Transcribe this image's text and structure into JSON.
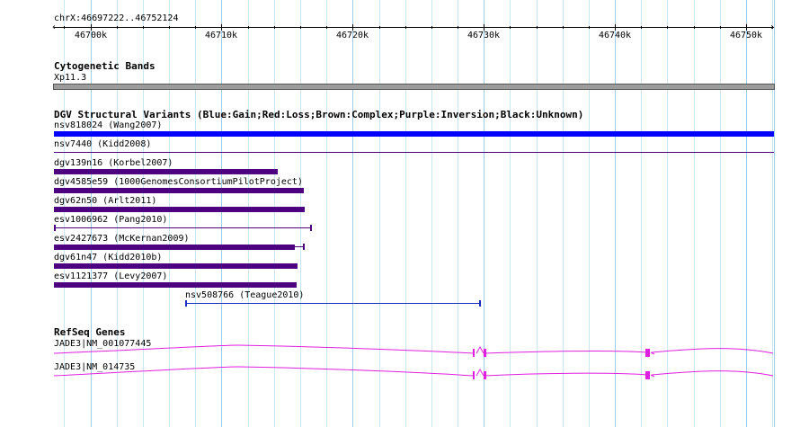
{
  "location": {
    "label": "chrX:46697222..46752124"
  },
  "ruler": {
    "ticks": [
      {
        "pos": 46700000,
        "label": "46700k"
      },
      {
        "pos": 46710000,
        "label": "46710k"
      },
      {
        "pos": 46720000,
        "label": "46720k"
      },
      {
        "pos": 46730000,
        "label": "46730k"
      },
      {
        "pos": 46740000,
        "label": "46740k"
      },
      {
        "pos": 46750000,
        "label": "46750k"
      }
    ]
  },
  "cytobands": {
    "title": "Cytogenetic Bands",
    "band_label": "Xp11.3",
    "band_color": "#9c9c9c"
  },
  "dgv": {
    "title": "DGV Structural Variants (Blue:Gain;Red:Loss;Brown:Complex;Purple:Inversion;Black:Unknown)",
    "colors": {
      "gain": "#0000ff",
      "inversion": "#4d0080",
      "gain_thin": "#1a2fbf"
    },
    "variants": [
      {
        "id": "nsv818024",
        "label": "nsv818024 (Wang2007)",
        "start": 46697222,
        "end": 46752124,
        "type": "gain",
        "style": "thick"
      },
      {
        "id": "nsv7440",
        "label": "nsv7440 (Kidd2008)",
        "start": 46697222,
        "end": 46752124,
        "type": "inversion",
        "style": "thin"
      },
      {
        "id": "dgv139n16",
        "label": "dgv139n16 (Korbel2007)",
        "start": 46697222,
        "end": 46714300,
        "type": "inversion",
        "style": "thick"
      },
      {
        "id": "dgv4585e59",
        "label": "dgv4585e59 (1000GenomesConsortiumPilotProject)",
        "start": 46697222,
        "end": 46716300,
        "type": "inversion",
        "style": "thick"
      },
      {
        "id": "dgv62n50",
        "label": "dgv62n50 (Arlt2011)",
        "start": 46697222,
        "end": 46716350,
        "type": "inversion",
        "style": "thick"
      },
      {
        "id": "esv1006962",
        "label": "esv1006962 (Pang2010)",
        "start": 46697222,
        "end": 46716800,
        "type": "inversion",
        "style": "thin-capped"
      },
      {
        "id": "esv2427673",
        "label": "esv2427673 (McKernan2009)",
        "start": 46697222,
        "end": 46716300,
        "type": "inversion",
        "style": "thick-capped",
        "thick_end": 46715600
      },
      {
        "id": "dgv61n47",
        "label": "dgv61n47 (Kidd2010b)",
        "start": 46697222,
        "end": 46715800,
        "type": "inversion",
        "style": "thick"
      },
      {
        "id": "esv1121377",
        "label": "esv1121377 (Levy2007)",
        "start": 46697222,
        "end": 46715700,
        "type": "inversion",
        "style": "thick"
      },
      {
        "id": "nsv508766",
        "label": "nsv508766 (Teague2010)",
        "start": 46707200,
        "end": 46729700,
        "type": "gain",
        "style": "thin-capped"
      }
    ]
  },
  "refseq": {
    "title": "RefSeq Genes",
    "color": "#e020e0",
    "genes": [
      {
        "label": "JADE3|NM_001077445"
      },
      {
        "label": "JADE3|NM_014735"
      }
    ]
  }
}
